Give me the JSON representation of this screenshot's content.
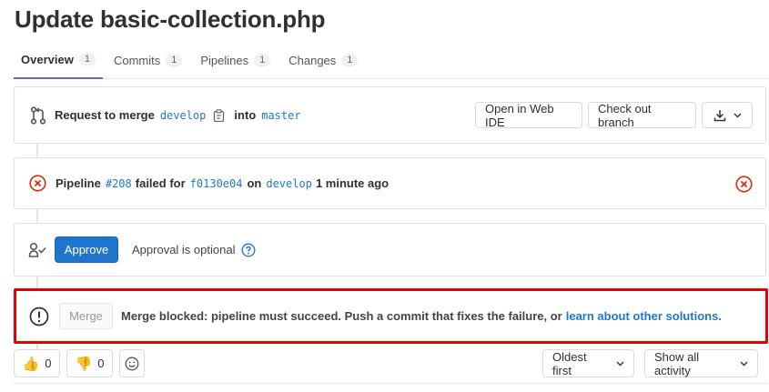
{
  "title": "Update basic-collection.php",
  "tabs": [
    {
      "label": "Overview",
      "count": "1"
    },
    {
      "label": "Commits",
      "count": "1"
    },
    {
      "label": "Pipelines",
      "count": "1"
    },
    {
      "label": "Changes",
      "count": "1"
    }
  ],
  "request": {
    "prefix": "Request to merge",
    "source_branch": "develop",
    "into": "into",
    "target_branch": "master",
    "open_web_ide": "Open in Web IDE",
    "check_out_branch": "Check out branch"
  },
  "pipeline": {
    "label": "Pipeline",
    "id": "#208",
    "failed_for": "failed for",
    "commit": "f0130e04",
    "on": "on",
    "branch": "develop",
    "time": "1 minute ago"
  },
  "approval": {
    "approve_label": "Approve",
    "optional_text": "Approval is optional"
  },
  "merge": {
    "button_label": "Merge",
    "blocked_text": "Merge blocked: pipeline must succeed. Push a commit that fixes the failure, or",
    "link_text": "learn about other solutions."
  },
  "footer": {
    "thumbs_up_count": "0",
    "thumbs_down_count": "0",
    "sort_label": "Oldest first",
    "activity_label": "Show all activity"
  },
  "colors": {
    "link": "#1f78d1",
    "approve": "#1f75cb",
    "error": "#dd2b0e",
    "highlight": "#e60000"
  }
}
